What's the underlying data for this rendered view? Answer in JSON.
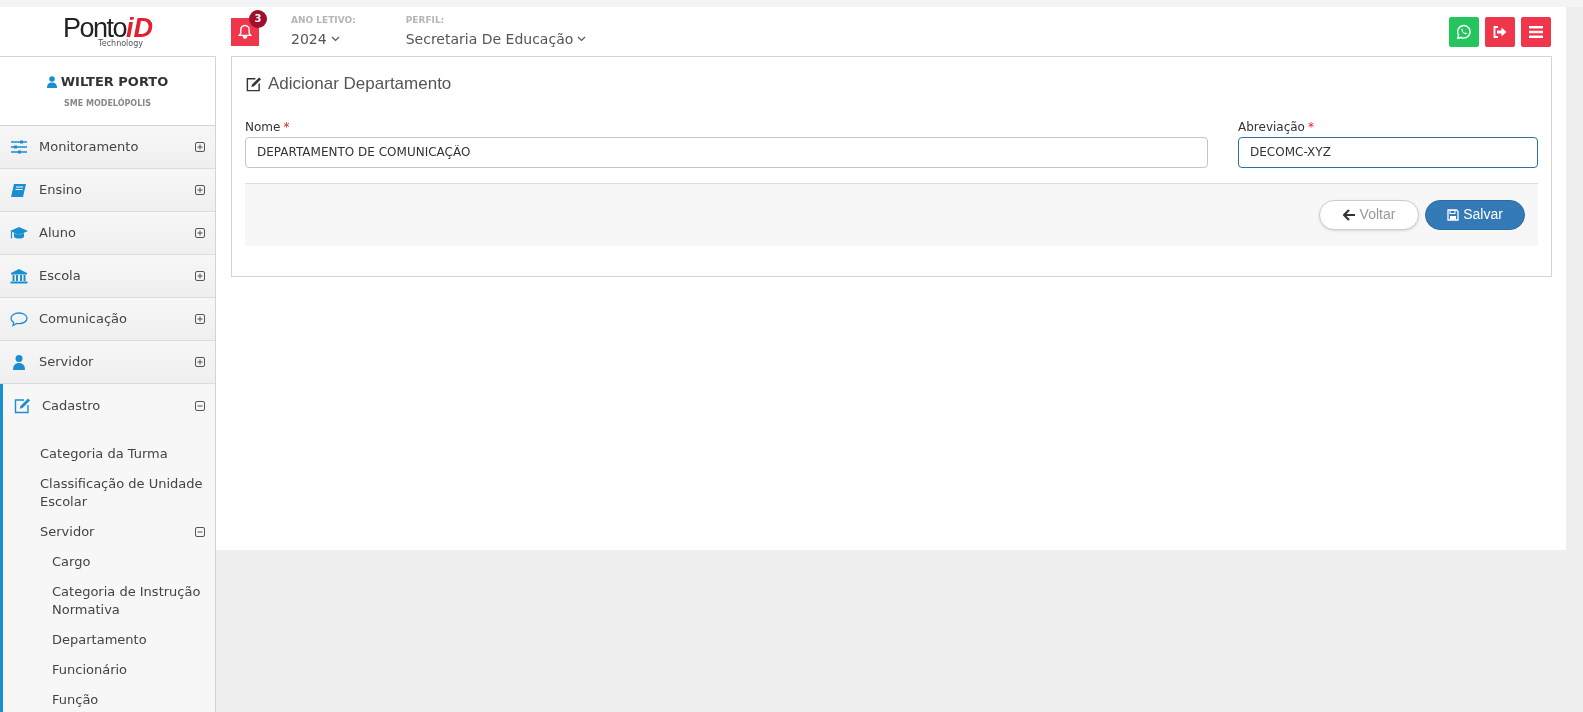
{
  "header": {
    "logo": {
      "brand": "Ponto",
      "accent": "iD",
      "tagline": "Technology"
    },
    "notifications": {
      "count": "3"
    },
    "year": {
      "label": "ANO LETIVO:",
      "value": "2024"
    },
    "profile": {
      "label": "PERFIL:",
      "value": "Secretaria De Educação"
    },
    "actions": [
      {
        "kind": "whatsapp"
      },
      {
        "kind": "logout"
      },
      {
        "kind": "menu"
      }
    ]
  },
  "user": {
    "name": "WILTER PORTO",
    "organization": "SME MODELÓPOLIS"
  },
  "sidebar": {
    "items": [
      {
        "kind": "sliders",
        "label": "Monitoramento",
        "expanded": false
      },
      {
        "kind": "book",
        "label": "Ensino",
        "expanded": false
      },
      {
        "kind": "cap",
        "label": "Aluno",
        "expanded": false
      },
      {
        "kind": "bank",
        "label": "Escola",
        "expanded": false
      },
      {
        "kind": "chat",
        "label": "Comunicação",
        "expanded": false
      },
      {
        "kind": "user",
        "label": "Servidor",
        "expanded": false
      },
      {
        "kind": "edit",
        "label": "Cadastro",
        "expanded": true,
        "children": [
          {
            "label": "Categoria da Turma"
          },
          {
            "label": "Classificação de Unidade Escolar"
          },
          {
            "label": "Servidor",
            "expanded": true,
            "children": [
              {
                "label": "Cargo"
              },
              {
                "label": "Categoria de Instrução Normativa"
              },
              {
                "label": "Departamento"
              },
              {
                "label": "Funcionário"
              },
              {
                "label": "Função"
              }
            ]
          }
        ]
      }
    ]
  },
  "form": {
    "title": "Adicionar Departamento",
    "fields": [
      {
        "label": "Nome",
        "required_mark": "*",
        "value": "DEPARTAMENTO DE COMUNICAÇÃO",
        "focused": false
      },
      {
        "label": "Abreviação",
        "required_mark": "*",
        "value": "DECOMC-XYZ",
        "focused": true
      }
    ],
    "buttons": [
      {
        "kind": "back",
        "label": "Voltar"
      },
      {
        "kind": "save",
        "label": "Salvar"
      }
    ]
  }
}
